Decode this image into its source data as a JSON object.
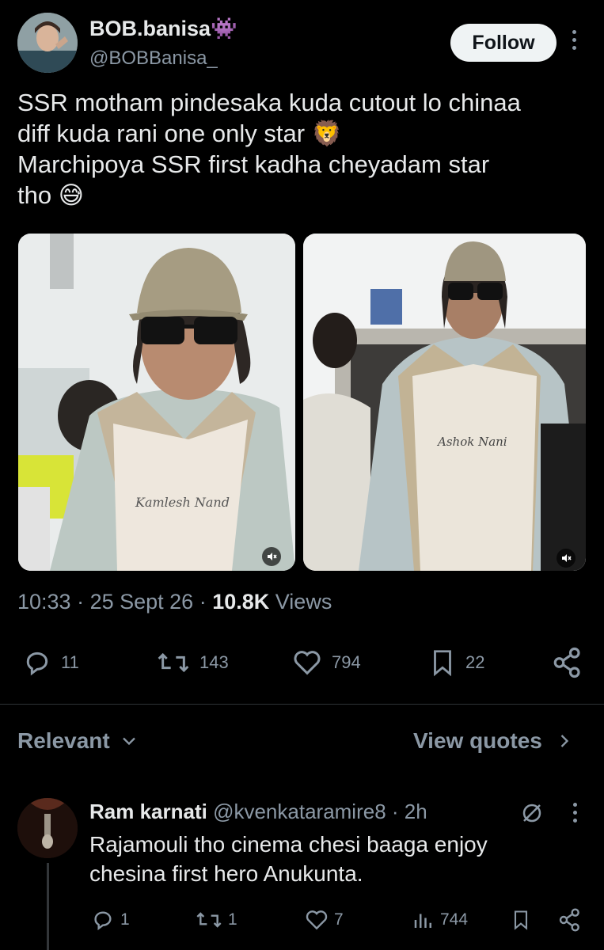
{
  "author": {
    "name": "BOB.banisa",
    "name_emoji": "👾",
    "handle": "@BOBBanisa_",
    "follow_label": "Follow"
  },
  "tweet": {
    "line1": "SSR motham pindesaka kuda cutout lo chinaa",
    "line2": "diff kuda rani one only star 🦁",
    "line3": "Marchipoya SSR first kadha cheyadam star",
    "line4": "tho 😅",
    "time": "10:33",
    "date": "25 Sept 26",
    "views_count": "10.8K",
    "views_label": "Views",
    "media": [
      {
        "shirt_text": "Kamlesh Nand"
      },
      {
        "shirt_text": "Ashok Nani"
      }
    ]
  },
  "actions": {
    "replies": "11",
    "reposts": "143",
    "likes": "794",
    "bookmarks": "22"
  },
  "sort": {
    "label": "Relevant",
    "view_quotes": "View quotes"
  },
  "reply": {
    "name": "Ram karnati",
    "handle": "@kvenkataramire8",
    "time": "2h",
    "text_line1": "Rajamouli tho cinema chesi baaga enjoy",
    "text_line2": "chesina first hero Anukunta.",
    "replies": "1",
    "reposts": "1",
    "likes": "7",
    "views": "744"
  },
  "colors": {
    "background": "#000000",
    "text": "#e7e9ea",
    "muted": "#8b98a5",
    "divider": "#2f3336"
  }
}
